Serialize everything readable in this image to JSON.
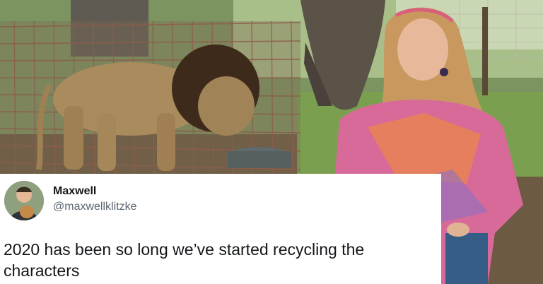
{
  "tweet": {
    "display_name": "Maxwell",
    "handle": "@maxwellklitzke",
    "text": "2020 has been so long we’ve started recycling the characters"
  },
  "photo": {
    "subjects": [
      "lion-in-cage",
      "woman-with-flower-crown"
    ]
  },
  "colors": {
    "tweet_background": "#ffffff",
    "name_color": "#14171a",
    "handle_color": "#5b6670"
  }
}
